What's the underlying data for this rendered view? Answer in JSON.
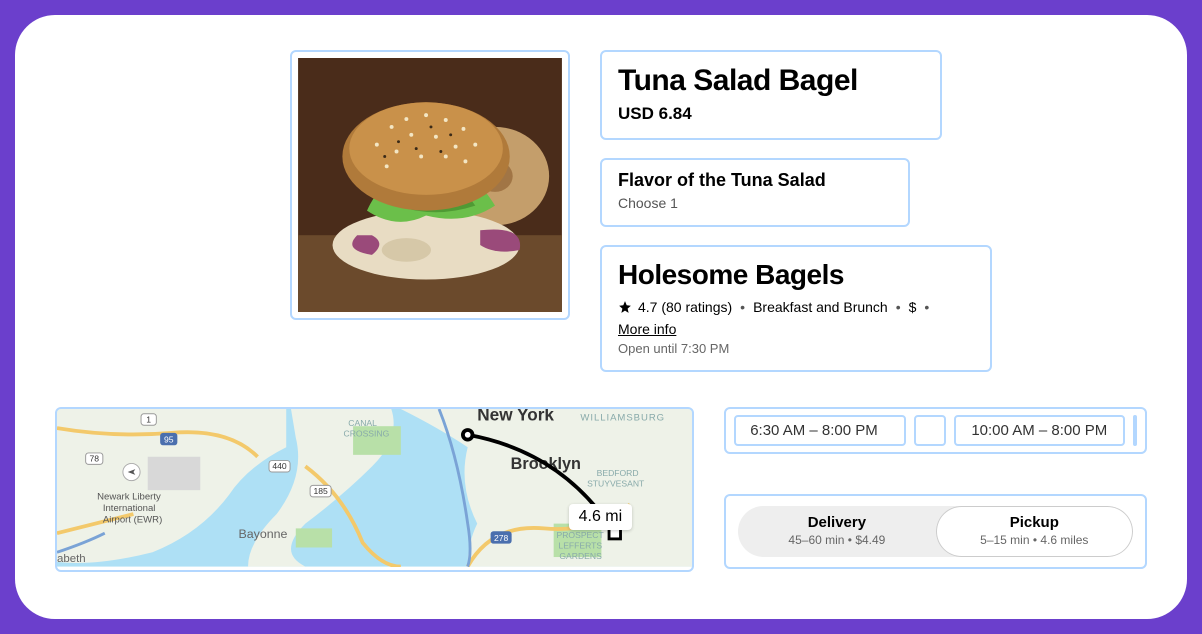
{
  "product": {
    "name": "Tuna Salad Bagel",
    "price": "USD 6.84"
  },
  "flavor": {
    "heading": "Flavor of the Tuna Salad",
    "sub": "Choose 1"
  },
  "restaurant": {
    "name": "Holesome Bagels",
    "rating": "4.7 (80 ratings)",
    "category": "Breakfast and Brunch",
    "price_tier": "$",
    "more_info": "More info",
    "open_until": "Open until 7:30 PM"
  },
  "map": {
    "distance": "4.6 mi",
    "labels": {
      "ny": "New York",
      "brooklyn": "Brooklyn",
      "williamsburg": "WILLIAMSBURG",
      "canal": "CANAL\nCROSSING",
      "bayonne": "Bayonne",
      "bedford": "BEDFORD\nSTUYVESANT",
      "prospect": "PROSPECT\nLEFFERTS\nGARDENS",
      "newark": "Newark Liberty\nInternational\nAirport (EWR)",
      "abeth": "abeth"
    },
    "roads": {
      "r1": "1",
      "r95": "95",
      "r78": "78",
      "r440": "440",
      "r185": "185",
      "r278": "278"
    }
  },
  "hours": {
    "slot1": "6:30 AM – 8:00 PM",
    "slot2": "10:00 AM – 8:00 PM"
  },
  "fulfillment": {
    "delivery": {
      "label": "Delivery",
      "sub": "45–60 min • $4.49"
    },
    "pickup": {
      "label": "Pickup",
      "sub": "5–15 min • 4.6 miles"
    }
  }
}
